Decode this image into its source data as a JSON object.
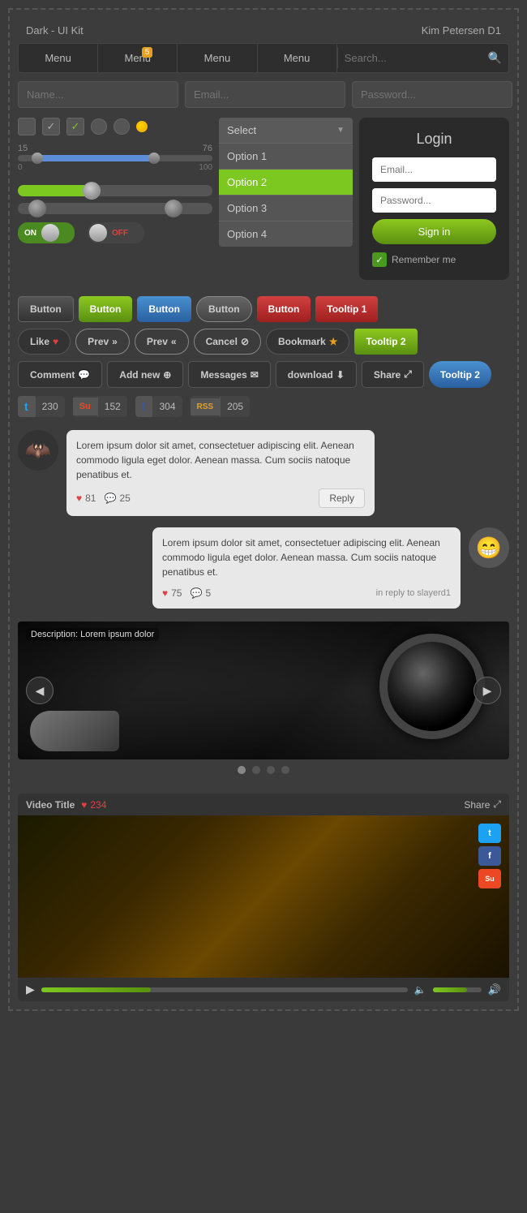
{
  "header": {
    "title_left": "Dark - UI Kit",
    "title_right": "Kim Petersen D1"
  },
  "nav": {
    "items": [
      "Menu",
      "Menu",
      "Menu",
      "Menu"
    ],
    "badge": "5",
    "search_placeholder": "Search..."
  },
  "form": {
    "name_placeholder": "Name...",
    "email_placeholder": "Email...",
    "password_placeholder": "Password..."
  },
  "slider": {
    "val1": "15",
    "val2": "76",
    "min": "0",
    "max": "100"
  },
  "dropdown": {
    "selected": "Select",
    "options": [
      "Option 1",
      "Option 2",
      "Option 3",
      "Option 4"
    ],
    "active_index": 1
  },
  "toggles": {
    "on_label": "ON",
    "off_label": "OFF"
  },
  "login": {
    "title": "Login",
    "email_placeholder": "Email...",
    "password_placeholder": "Password...",
    "sign_in": "Sign in",
    "remember": "Remember me"
  },
  "buttons": {
    "row1": [
      "Button",
      "Button",
      "Button",
      "Button",
      "Button",
      "Tooltip 1"
    ],
    "row2_labels": [
      "Like",
      "Prev",
      "Prev",
      "Cancel",
      "Bookmark",
      "Tooltip 2"
    ],
    "row3_labels": [
      "Comment",
      "Add new",
      "Messages",
      "download",
      "Share",
      "Tooltip 2"
    ]
  },
  "social": {
    "twitter": {
      "icon": "𝕏",
      "count": "230"
    },
    "stumble": {
      "icon": "Su",
      "count": "152"
    },
    "facebook": {
      "icon": "f",
      "count": "304"
    },
    "rss": {
      "icon": "RSS",
      "count": "205"
    }
  },
  "chat": {
    "bubble1": {
      "text": "Lorem ipsum dolor sit amet, consectetuer adipiscing elit. Aenean commodo ligula eget dolor. Aenean massa. Cum sociis natoque penatibus et.",
      "likes": "81",
      "comments": "25",
      "reply_label": "Reply"
    },
    "bubble2": {
      "text": "Lorem ipsum dolor sit amet, consectetuer adipiscing elit. Aenean commodo ligula eget dolor. Aenean massa. Cum sociis natoque penatibus et.",
      "likes": "75",
      "comments": "5",
      "in_reply": "in reply to slayerd1"
    }
  },
  "carousel": {
    "description": "Description: Lorem ipsum dolor",
    "dots": 4,
    "active_dot": 0,
    "prev": "◀",
    "next": "▶"
  },
  "video": {
    "title": "Video Title",
    "likes": "234",
    "share_label": "Share",
    "social": [
      "t",
      "f",
      "Su"
    ],
    "play_icon": "▶",
    "volume_icon": "🔊"
  }
}
